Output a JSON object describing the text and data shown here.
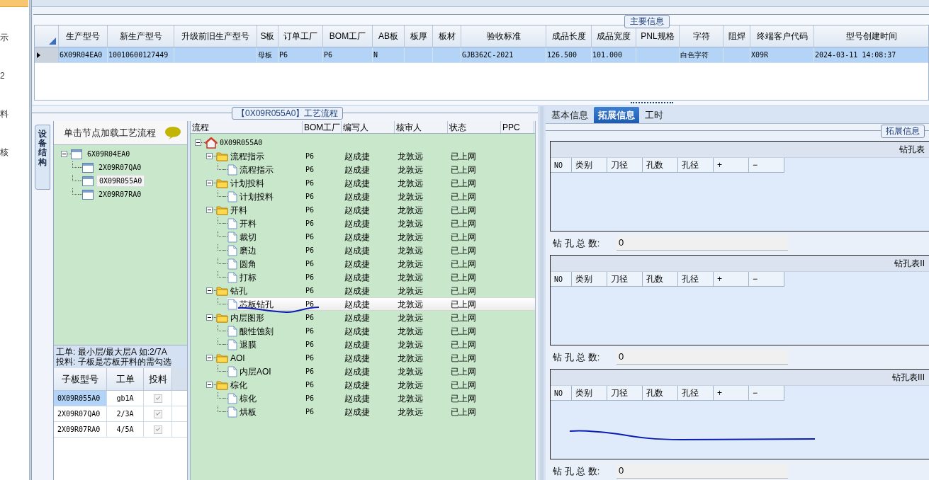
{
  "sidebar": {
    "items": [
      {
        "label": "示"
      },
      {
        "label": "2"
      },
      {
        "label": "料"
      },
      {
        "label": "核"
      }
    ]
  },
  "main_info": {
    "title": "主要信息",
    "columns": [
      "生产型号",
      "新生产型号",
      "升级前旧生产型号",
      "S板",
      "订单工厂",
      "BOM工厂",
      "AB板",
      "板厚",
      "板材",
      "验收标准",
      "成品长度",
      "成品宽度",
      "PNL规格",
      "字符",
      "阻焊",
      "终端客户代码",
      "型号创建时间"
    ],
    "rows": [
      {
        "selected": true,
        "cells": {
          "0": "6X09R04EA0",
          "1": "10010600127449",
          "3": "母板",
          "4": "P6",
          "5": "P6",
          "6": "N",
          "9": "GJB362C-2021",
          "10": "126.500",
          "11": "101.000",
          "13": "白色字符",
          "15": "X09R",
          "16": "2024-03-11 14:08:37"
        }
      }
    ]
  },
  "process_panel": {
    "title": "【0X09R055A0】工艺流程",
    "side_tab": "设备结构",
    "hint": "单击节点加载工艺流程",
    "device_tree": [
      {
        "label": "6X09R04EA0",
        "expanded": true,
        "selected": false,
        "children": [
          {
            "label": "2X09R07QA0",
            "selected": false
          },
          {
            "label": "0X09R055A0",
            "selected": true
          },
          {
            "label": "2X09R07RA0",
            "selected": false
          }
        ]
      }
    ],
    "notes": [
      "工单: 最小层/最大层A 如:2/7A",
      "投料: 子板是芯板开料的需勾选"
    ],
    "sub_boards": {
      "columns": [
        "子板型号",
        "工单",
        "投料"
      ],
      "rows": [
        {
          "board": "0X09R055A0",
          "order": "gb1A",
          "feed": true,
          "selected": true
        },
        {
          "board": "2X09R07QA0",
          "order": "2/3A",
          "feed": true,
          "selected": false
        },
        {
          "board": "2X09R07RA0",
          "order": "4/5A",
          "feed": true,
          "selected": false
        }
      ]
    },
    "flow": {
      "columns": [
        "流程",
        "BOM工厂",
        "编写人",
        "核审人",
        "状态",
        "PPC"
      ],
      "tree": [
        {
          "kind": "root",
          "label": "0X09R055A0",
          "expanded": true,
          "selected": false,
          "children": [
            {
              "kind": "group",
              "label": "流程指示",
              "bom": "P6",
              "writer": "赵成捷",
              "reviewer": "龙敦远",
              "status": "已上网",
              "expanded": true,
              "selected": false,
              "children": [
                {
                  "kind": "step",
                  "label": "流程指示",
                  "bom": "P6",
                  "writer": "赵成捷",
                  "reviewer": "龙敦远",
                  "status": "已上网",
                  "selected": false
                }
              ]
            },
            {
              "kind": "group",
              "label": "计划投料",
              "bom": "P6",
              "writer": "赵成捷",
              "reviewer": "龙敦远",
              "status": "已上网",
              "expanded": true,
              "selected": false,
              "children": [
                {
                  "kind": "step",
                  "label": "计划投料",
                  "bom": "P6",
                  "writer": "赵成捷",
                  "reviewer": "龙敦远",
                  "status": "已上网",
                  "selected": false
                }
              ]
            },
            {
              "kind": "group",
              "label": "开料",
              "bom": "P6",
              "writer": "赵成捷",
              "reviewer": "龙敦远",
              "status": "已上网",
              "expanded": true,
              "selected": false,
              "children": [
                {
                  "kind": "step",
                  "label": "开料",
                  "bom": "P6",
                  "writer": "赵成捷",
                  "reviewer": "龙敦远",
                  "status": "已上网",
                  "selected": false
                },
                {
                  "kind": "step",
                  "label": "裁切",
                  "bom": "P6",
                  "writer": "赵成捷",
                  "reviewer": "龙敦远",
                  "status": "已上网",
                  "selected": false
                },
                {
                  "kind": "step",
                  "label": "磨边",
                  "bom": "P6",
                  "writer": "赵成捷",
                  "reviewer": "龙敦远",
                  "status": "已上网",
                  "selected": false
                },
                {
                  "kind": "step",
                  "label": "圆角",
                  "bom": "P6",
                  "writer": "赵成捷",
                  "reviewer": "龙敦远",
                  "status": "已上网",
                  "selected": false
                },
                {
                  "kind": "step",
                  "label": "打标",
                  "bom": "P6",
                  "writer": "赵成捷",
                  "reviewer": "龙敦远",
                  "status": "已上网",
                  "selected": false
                }
              ]
            },
            {
              "kind": "group",
              "label": "钻孔",
              "bom": "P6",
              "writer": "赵成捷",
              "reviewer": "龙敦远",
              "status": "已上网",
              "expanded": true,
              "selected": false,
              "children": [
                {
                  "kind": "step",
                  "label": "芯板钻孔",
                  "bom": "P6",
                  "writer": "赵成捷",
                  "reviewer": "龙敦远",
                  "status": "已上网",
                  "selected": true
                }
              ]
            },
            {
              "kind": "group",
              "label": "内层图形",
              "bom": "P6",
              "writer": "赵成捷",
              "reviewer": "龙敦远",
              "status": "已上网",
              "expanded": true,
              "selected": false,
              "children": [
                {
                  "kind": "step",
                  "label": "酸性蚀刻",
                  "bom": "P6",
                  "writer": "赵成捷",
                  "reviewer": "龙敦远",
                  "status": "已上网",
                  "selected": false
                },
                {
                  "kind": "step",
                  "label": "退膜",
                  "bom": "P6",
                  "writer": "赵成捷",
                  "reviewer": "龙敦远",
                  "status": "已上网",
                  "selected": false
                }
              ]
            },
            {
              "kind": "group",
              "label": "AOI",
              "bom": "P6",
              "writer": "赵成捷",
              "reviewer": "龙敦远",
              "status": "已上网",
              "expanded": true,
              "selected": false,
              "children": [
                {
                  "kind": "step",
                  "label": "内层AOI",
                  "bom": "P6",
                  "writer": "赵成捷",
                  "reviewer": "龙敦远",
                  "status": "已上网",
                  "selected": false
                }
              ]
            },
            {
              "kind": "group",
              "label": "棕化",
              "bom": "P6",
              "writer": "赵成捷",
              "reviewer": "龙敦远",
              "status": "已上网",
              "expanded": true,
              "selected": false,
              "children": [
                {
                  "kind": "step",
                  "label": "棕化",
                  "bom": "P6",
                  "writer": "赵成捷",
                  "reviewer": "龙敦远",
                  "status": "已上网",
                  "selected": false
                },
                {
                  "kind": "step",
                  "label": "烘板",
                  "bom": "P6",
                  "writer": "赵成捷",
                  "reviewer": "龙敦远",
                  "status": "已上网",
                  "selected": false
                }
              ]
            }
          ]
        }
      ]
    }
  },
  "details": {
    "tabs": [
      {
        "label": "基本信息",
        "selected": false
      },
      {
        "label": "拓展信息",
        "selected": true
      },
      {
        "label": "工时",
        "selected": false
      }
    ],
    "group_title": "拓展信息",
    "drill_tables": [
      {
        "title": "钻孔表",
        "columns": [
          "NO",
          "类别",
          "刀径",
          "孔数",
          "孔径",
          "+",
          "−"
        ],
        "total_label": "钻 孔 总 数:",
        "total_value": "0"
      },
      {
        "title": "钻孔表II",
        "columns": [
          "NO",
          "类别",
          "刀径",
          "孔数",
          "孔径",
          "+",
          "−"
        ],
        "total_label": "钻 孔 总 数:",
        "total_value": "0"
      },
      {
        "title": "钻孔表III",
        "columns": [
          "NO",
          "类别",
          "刀径",
          "孔数",
          "孔径",
          "+",
          "−"
        ],
        "total_label": "钻 孔 总 数:",
        "total_value": "0"
      }
    ]
  }
}
